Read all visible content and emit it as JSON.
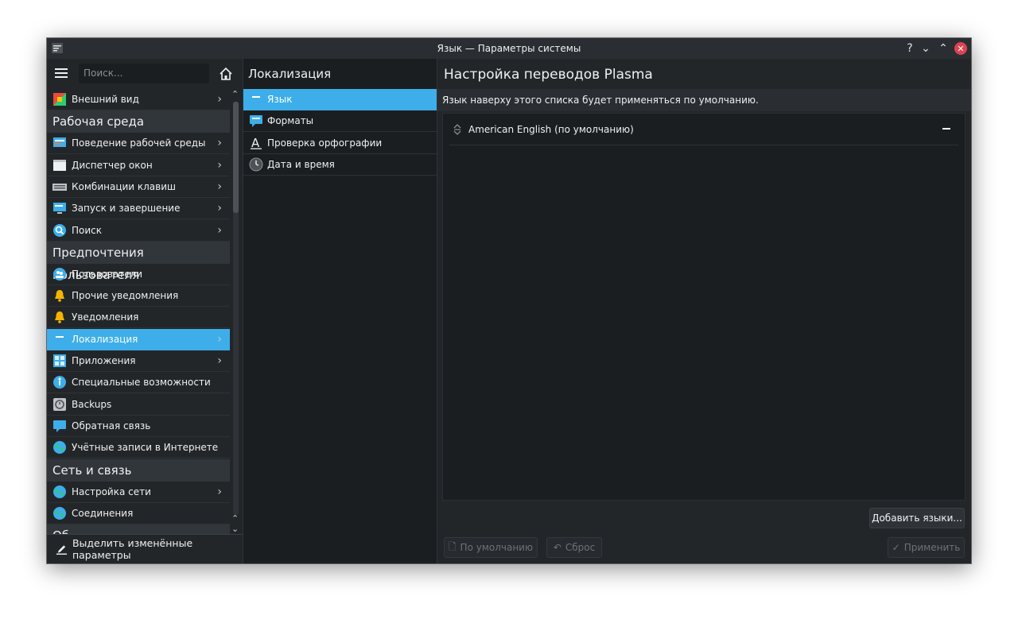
{
  "titlebar": {
    "title": "Язык — Параметры системы",
    "help": "?",
    "minimize": "⌄",
    "maximize": "⌃",
    "close": "✕"
  },
  "sidebar": {
    "search_placeholder": "Поиск...",
    "rows": [
      {
        "kind": "item",
        "label": "Внешний вид",
        "icon": "appearance-icon",
        "chevron": true
      },
      {
        "kind": "category",
        "label": "Рабочая среда"
      },
      {
        "kind": "item",
        "label": "Поведение рабочей среды",
        "icon": "desktop-behavior-icon",
        "chevron": true
      },
      {
        "kind": "item",
        "label": "Диспетчер окон",
        "icon": "window-manager-icon",
        "chevron": true
      },
      {
        "kind": "item",
        "label": "Комбинации клавиш",
        "icon": "keyboard-icon",
        "chevron": true
      },
      {
        "kind": "item",
        "label": "Запуск и завершение",
        "icon": "startup-icon",
        "chevron": true
      },
      {
        "kind": "item",
        "label": "Поиск",
        "icon": "search-icon",
        "chevron": true
      },
      {
        "kind": "category",
        "label": "Предпочтения пользователя"
      },
      {
        "kind": "item",
        "label": "Пользователи",
        "icon": "users-icon",
        "chevron": false
      },
      {
        "kind": "item",
        "label": "Прочие уведомления",
        "icon": "bell-icon",
        "chevron": false
      },
      {
        "kind": "item",
        "label": "Уведомления",
        "icon": "bell-icon",
        "chevron": false
      },
      {
        "kind": "item",
        "label": "Локализация",
        "icon": "localization-icon",
        "chevron": true,
        "selected": true
      },
      {
        "kind": "item",
        "label": "Приложения",
        "icon": "applications-icon",
        "chevron": true
      },
      {
        "kind": "item",
        "label": "Специальные возможности",
        "icon": "accessibility-icon",
        "chevron": false
      },
      {
        "kind": "item",
        "label": "Backups",
        "icon": "backups-icon",
        "chevron": false
      },
      {
        "kind": "item",
        "label": "Обратная связь",
        "icon": "feedback-icon",
        "chevron": false
      },
      {
        "kind": "item",
        "label": "Учётные записи в Интернете",
        "icon": "globe-icon",
        "chevron": false
      },
      {
        "kind": "category",
        "label": "Сеть и связь"
      },
      {
        "kind": "item",
        "label": "Настройка сети",
        "icon": "globe-icon",
        "chevron": true
      },
      {
        "kind": "item",
        "label": "Соединения",
        "icon": "globe-icon",
        "chevron": false
      },
      {
        "kind": "category",
        "label": "Об"
      }
    ],
    "bottom_label": "Выделить изменённые параметры"
  },
  "middle": {
    "title": "Локализация",
    "items": [
      {
        "label": "Язык",
        "icon": "localization-icon",
        "selected": true
      },
      {
        "label": "Форматы",
        "icon": "localization-icon"
      },
      {
        "label": "Проверка орфографии",
        "icon": "spellcheck-icon"
      },
      {
        "label": "Дата и время",
        "icon": "clock-icon"
      }
    ]
  },
  "content": {
    "title": "Настройка переводов Plasma",
    "info": "Язык наверху этого списка будет применяться по умолчанию.",
    "languages": [
      "American English (по умолчанию)"
    ],
    "add_button": "Добавить языки...",
    "defaults_button": "По умолчанию",
    "reset_button": "Сброс",
    "apply_button": "Применить"
  },
  "colors": {
    "accent": "#3daee9",
    "window_bg": "#1b1e20",
    "sidebar_bg": "#232629",
    "close": "#da4453"
  }
}
